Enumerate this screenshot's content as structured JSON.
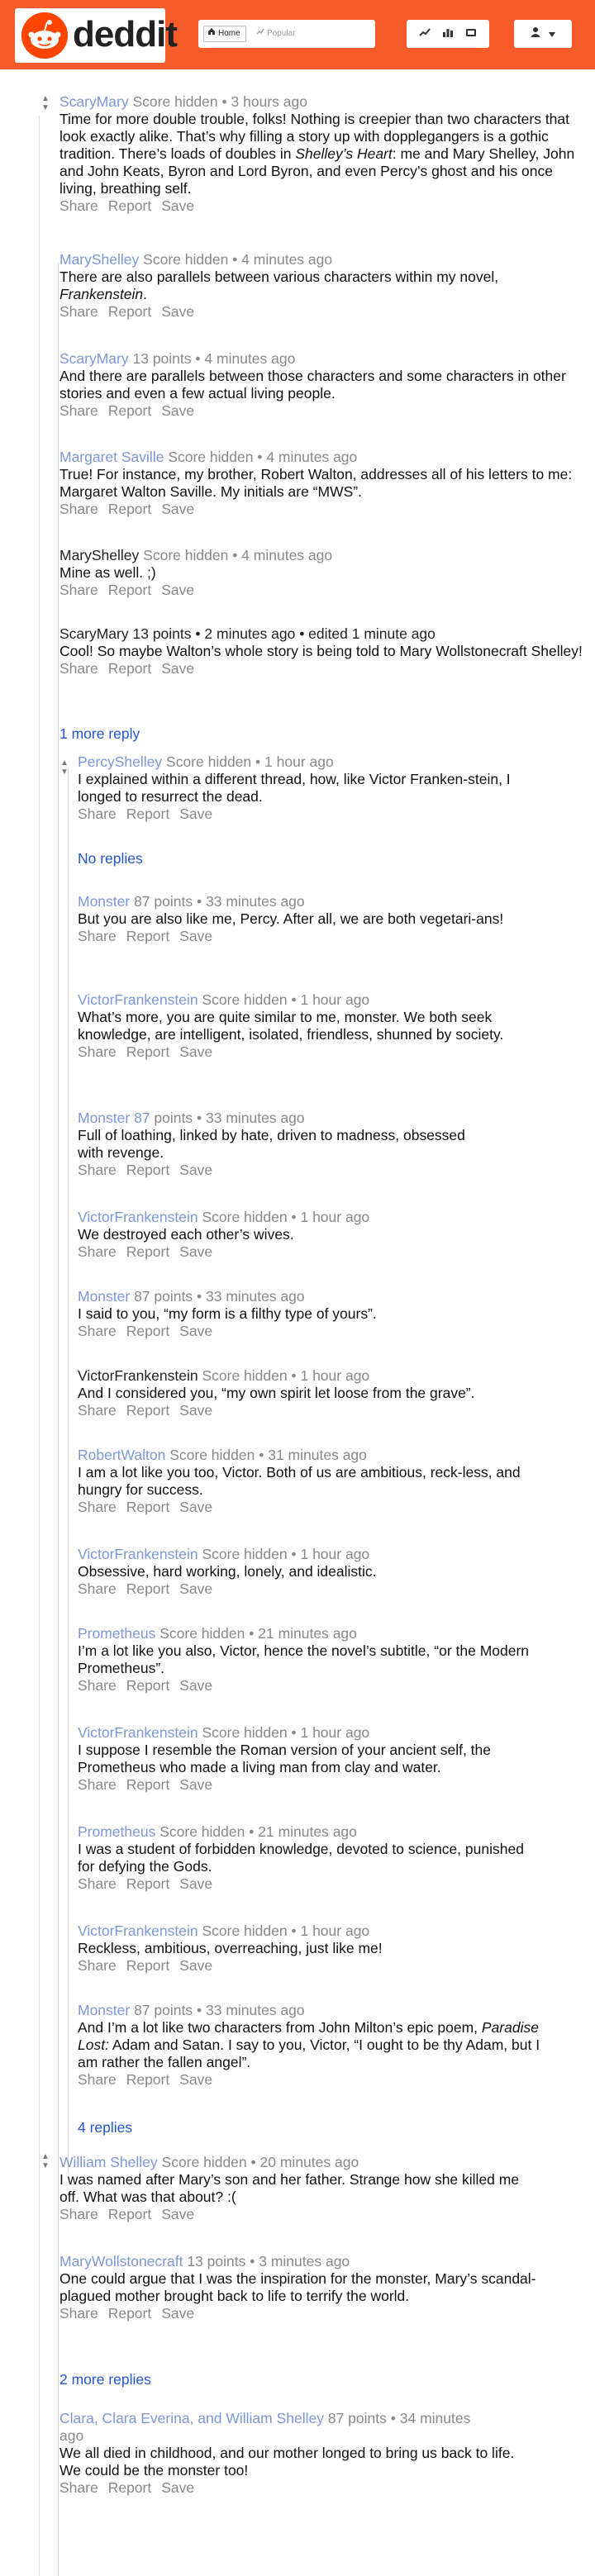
{
  "header": {
    "logo_text": "deddit",
    "tab_home": "Home",
    "tab_popular": "Popular",
    "icons": [
      "trending-icon",
      "bar-chart-icon",
      "tv-icon"
    ],
    "accent_color": "#f65b2a"
  },
  "comments": [
    {
      "author": "ScaryMary",
      "score": "Score hidden",
      "time": "• 3 hours ago",
      "body": "Time for more double trouble, folks! Nothing is creepier than two characters that look exactly alike. That’s why filling a story up with dopplegangers is a gothic tradition. There’s loads of doubles in Shelley’s Heart: me and Mary Shelley, John and John Keats, Byron and Lord Byron, and even Percy’s ghost and his once living, breathing self."
    },
    {
      "author": "MaryShelley",
      "score": "Score hidden",
      "time": "• 4 minutes ago",
      "body_pre": "There are also parallels between various characters within my novel, ",
      "body_em": "Frankenstein",
      "body_post": "."
    },
    {
      "author": "ScaryMary",
      "score": "13 points",
      "time": "• 4 minutes ago",
      "body": "And there are parallels between those characters and some characters in other stories and even a few actual living people."
    },
    {
      "author": "Margaret Saville",
      "score": "Score hidden",
      "time": "• 4 minutes ago",
      "body": "True! For instance, my brother, Robert Walton, addresses all of his letters to me: Margaret Walton Saville. My initials are “MWS”."
    },
    {
      "author": "MaryShelley",
      "score": "Score hidden",
      "time": "• 4 minutes ago",
      "body": "Mine as well. ;)"
    },
    {
      "author": "ScaryMary",
      "score": "13 points",
      "time": "• 2 minutes ago • edited 1 minute ago",
      "body": "Cool! So maybe Walton’s whole story is being told to Mary Wollstonecraft Shelley!"
    },
    {
      "author": "PercyShelley",
      "score": "Score hidden",
      "time": "• 1 hour ago",
      "body": "I explained within a different thread, how, like Victor Franken-stein, I longed to resurrect the dead."
    },
    {
      "author": "Monster",
      "score": "87 points",
      "time": "• 33 minutes ago",
      "body": "But you are also like me, Percy. After all, we are both vegetari-ans!"
    },
    {
      "author": "VictorFrankenstein",
      "score": "Score hidden",
      "time": "• 1 hour ago",
      "body": "What’s more, you are quite similar to me, monster. We both seek knowledge, are intelligent, isolated, friendless, shunned by society."
    },
    {
      "author": "Monster 87",
      "score": "points",
      "time": "• 33 minutes ago",
      "body": "Full of loathing, linked by hate, driven to madness, obsessed with revenge."
    },
    {
      "author": "VictorFrankenstein",
      "score": "Score hidden",
      "time": "• 1 hour ago",
      "body": "We destroyed each other’s wives."
    },
    {
      "author": "Monster",
      "score": "87 points",
      "time": "• 33 minutes ago",
      "body": "I said to you, “my form is a filthy type of yours”."
    },
    {
      "author": "VictorFrankenstein",
      "score": "Score hidden",
      "time": "• 1 hour ago",
      "body": "And I considered you, “my own spirit let loose from the grave”."
    },
    {
      "author": "RobertWalton",
      "score": "Score hidden",
      "time": "• 31 minutes ago",
      "body": "I am a lot like you too, Victor. Both of us are ambitious, reck-less, and hungry for success."
    },
    {
      "author": "VictorFrankenstein",
      "score": "Score hidden",
      "time": "• 1 hour ago",
      "body": "Obsessive, hard working, lonely, and idealistic."
    },
    {
      "author": "Prometheus",
      "score": "Score hidden",
      "time": "• 21 minutes ago",
      "body": "I’m a lot like you also, Victor, hence the novel’s subtitle, “or the Modern Prometheus”."
    },
    {
      "author": "VictorFrankenstein",
      "score": "Score hidden",
      "time": "• 1 hour ago",
      "body": "I suppose I resemble the Roman version of your ancient self, the Prometheus who made a living man from clay and water."
    },
    {
      "author": "Prometheus",
      "score": "Score hidden",
      "time": "• 21 minutes ago",
      "body": "I was a student of forbidden knowledge, devoted to science, punished for defying the Gods."
    },
    {
      "author": "VictorFrankenstein",
      "score": "Score hidden",
      "time": "• 1 hour ago",
      "body": "Reckless, ambitious, overreaching, just like me!"
    },
    {
      "author": "Monster",
      "score": "87 points",
      "time": "• 33 minutes ago",
      "body_pre": "And I’m a lot like two characters from John Milton’s epic poem, ",
      "body_em": "Paradise Lost:",
      "body_post": " Adam and Satan. I say to you, Victor, “I ought to be thy Adam, but I am rather the fallen angel”."
    },
    {
      "author": "William Shelley",
      "score": "Score hidden",
      "time": "• 20 minutes ago",
      "body": "I was named after Mary’s son and her father. Strange how she killed me off. What was that about? :("
    },
    {
      "author": "MaryWollstonecraft",
      "score": "13 points",
      "time": "• 3 minutes ago",
      "body": "One could argue that I was the inspiration for the monster, Mary’s scandal-plagued mother brought back to life to terrify the world."
    },
    {
      "author": "Clara, Clara Everina, and William Shelley",
      "score": "87 points",
      "time": "• 34 minutes",
      "time2": "ago",
      "body": "We all died in childhood, and our mother longed to bring us back to life. We could be the monster too!"
    }
  ],
  "actions": {
    "share": "Share",
    "report": "Report",
    "save": "Save"
  },
  "more": {
    "one_more_reply": "1 more reply",
    "no_replies": "No replies",
    "four_replies": "4 replies",
    "two_more_replies": "2 more replies"
  }
}
